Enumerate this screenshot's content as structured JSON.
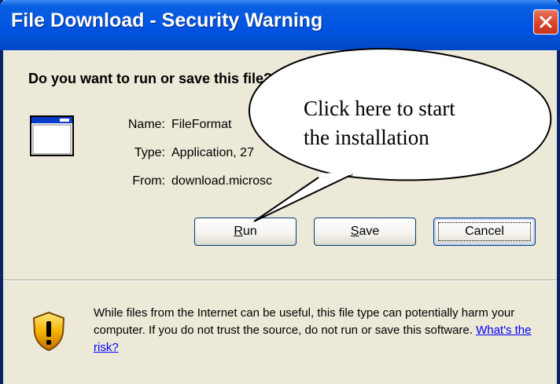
{
  "window": {
    "title": "File Download - Security Warning",
    "close_icon": "close-icon"
  },
  "dialog": {
    "question": "Do you want to run or save this file?",
    "file_icon": "application-window-icon",
    "fields": [
      {
        "label": "Name:",
        "value": "FileFormat"
      },
      {
        "label": "Type:",
        "value": "Application, 27"
      },
      {
        "label": "From:",
        "value": "download.microsc"
      }
    ],
    "buttons": {
      "run": {
        "mnemonic": "R",
        "rest": "un"
      },
      "save": {
        "mnemonic": "S",
        "rest": "ave"
      },
      "cancel": "Cancel"
    }
  },
  "footer": {
    "shield_icon": "security-shield-icon",
    "warning_text": "While files from the Internet can be useful, this file type can potentially harm your computer. If you do not trust the source, do not run or save this software.",
    "risk_link": "What's the risk?"
  },
  "callout": {
    "line1": "Click here to start",
    "line2": "the installation"
  },
  "colors": {
    "titlebar": "#0054e3",
    "dialog_bg": "#ece9d8",
    "close_button": "#d9402a",
    "link": "#0000ff"
  }
}
